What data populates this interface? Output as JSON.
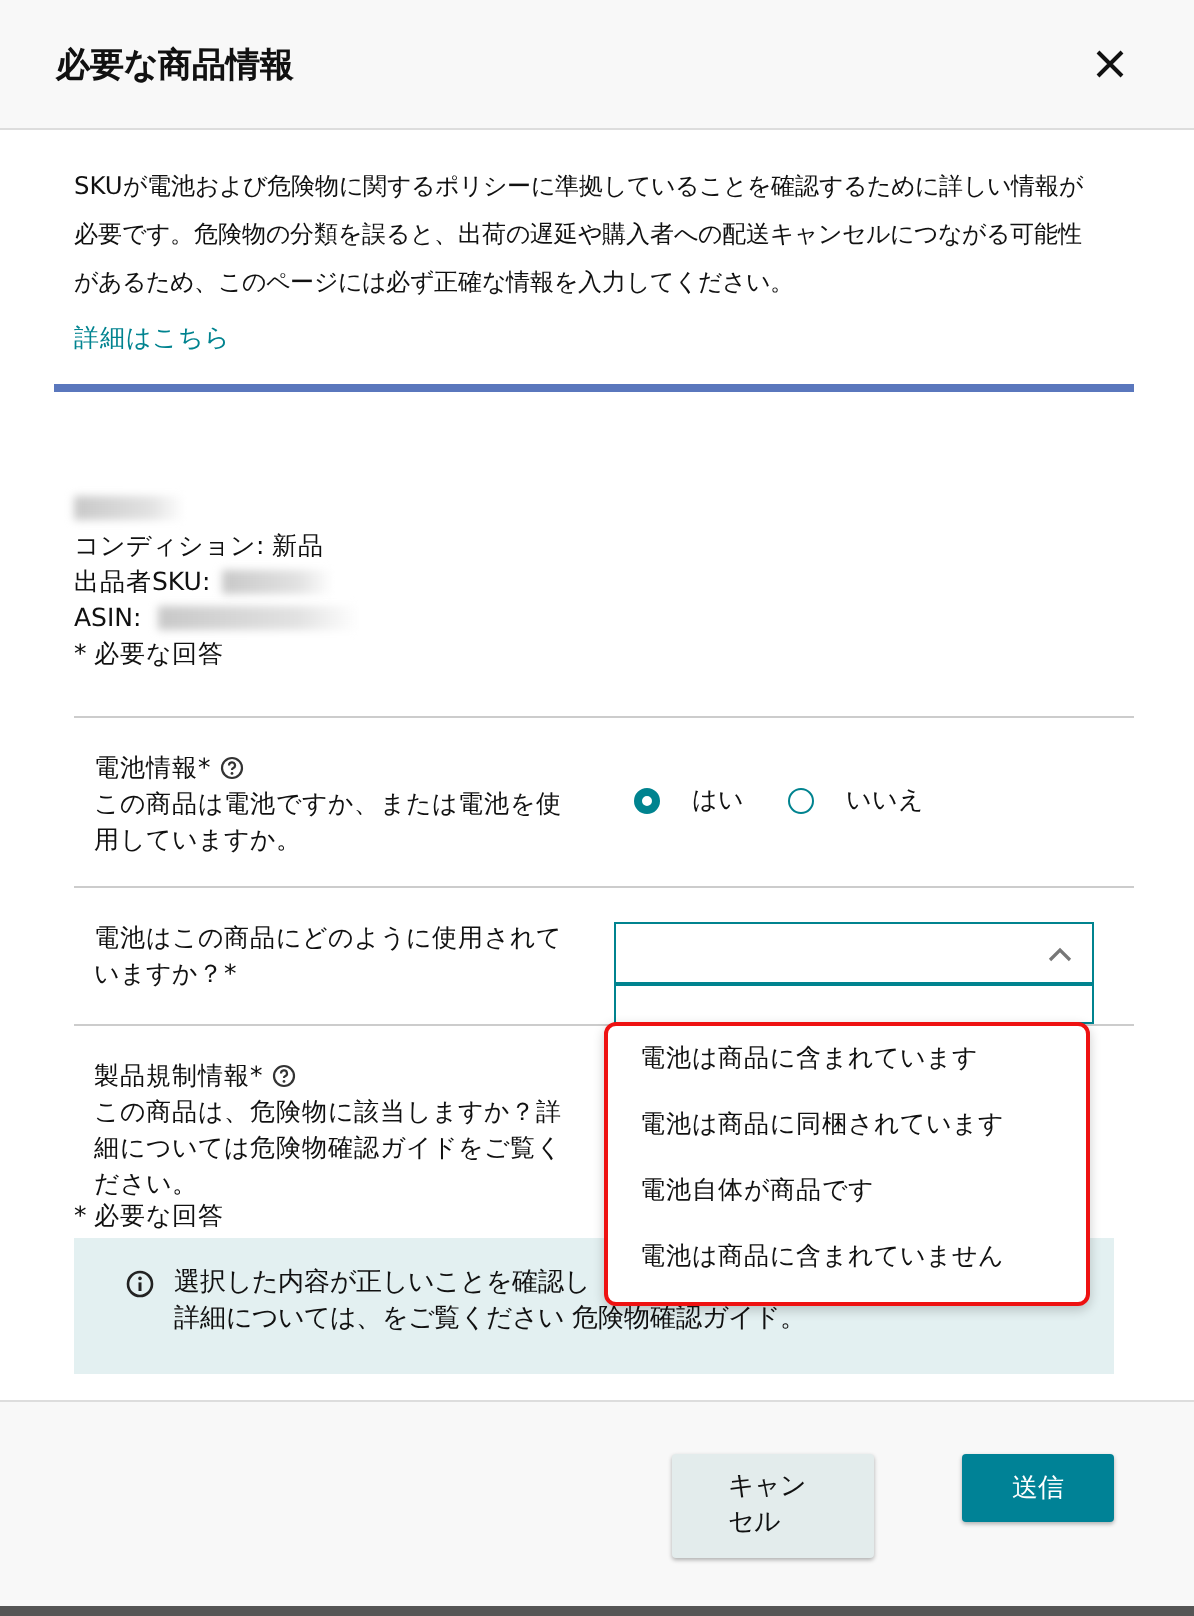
{
  "dialog": {
    "title": "必要な商品情報"
  },
  "intro": "SKUが電池および危険物に関するポリシーに準拠していることを確認するために詳しい情報が必要です。危険物の分類を誤ると、出荷の遅延や購入者への配送キャンセルにつながる可能性があるため、このページには必ず正確な情報を入力してください。",
  "learn_more_link": "詳細はこちら",
  "product": {
    "condition": "コンディション: 新品",
    "seller_sku_label": "出品者SKU:",
    "asin_label": "ASIN:",
    "required_note": "* 必要な回答"
  },
  "battery": {
    "label": "電池情報*",
    "question": "この商品は電池ですか、または電池を使用していますか。",
    "options": [
      {
        "label": "はい",
        "selected": true
      },
      {
        "label": "いいえ",
        "selected": false
      }
    ]
  },
  "usage": {
    "label": "電池はこの商品にどのように使用されていますか？*",
    "expanded": true,
    "options": [
      {
        "label": "電池は商品に含まれています"
      },
      {
        "label": "電池は商品に同梱されています"
      },
      {
        "label": "電池自体が商品です"
      },
      {
        "label": "電池は商品に含まれていません"
      }
    ]
  },
  "regulation": {
    "label": "製品規制情報*",
    "question": "この商品は、危険物に該当しますか？詳細については危険物確認ガイドをご覧ください。",
    "required_note": "* 必要な回答"
  },
  "notice": {
    "lines": [
      "選択した内容が正しいことを確認し",
      "詳細については、をご覧ください 危険物確認ガイド。"
    ]
  },
  "buttons": [
    {
      "label": "キャンセル",
      "kind": "secondary"
    },
    {
      "label": "送信",
      "kind": "primary"
    }
  ]
}
